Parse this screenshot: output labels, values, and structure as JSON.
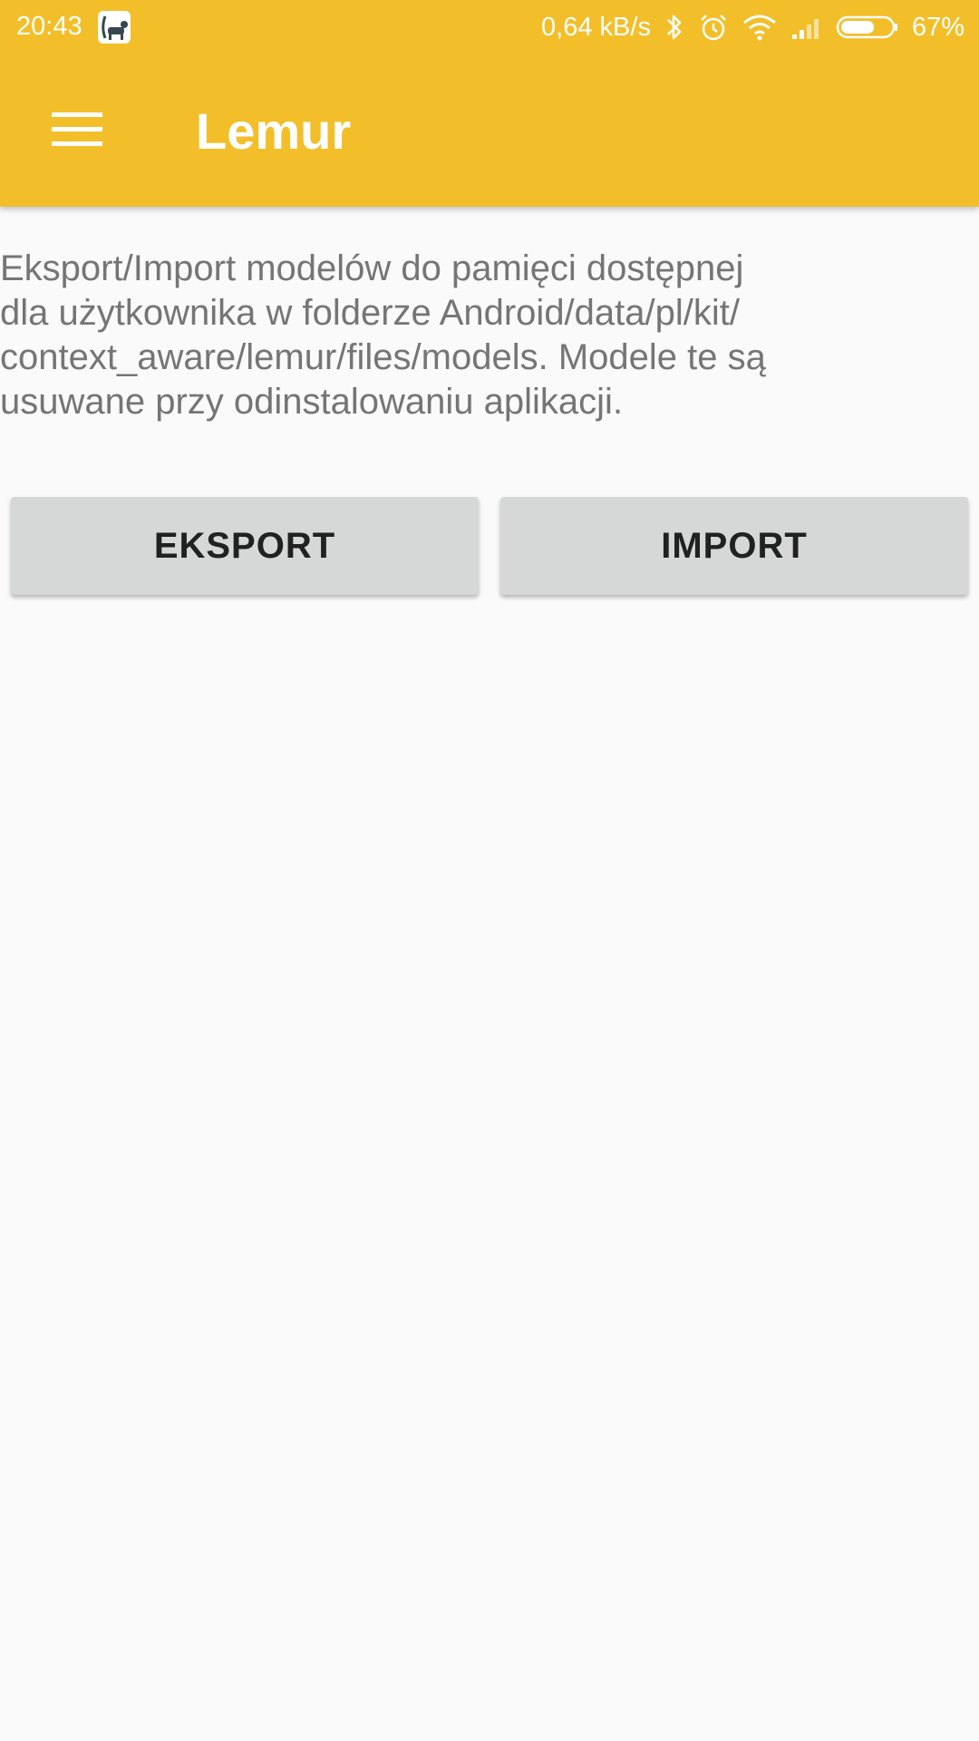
{
  "status_bar": {
    "time": "20:43",
    "network_speed": "0,64 kB/s",
    "battery_percent": "67%",
    "battery_level": 0.67,
    "icons": [
      "lemur-app-icon",
      "bluetooth-icon",
      "alarm-icon",
      "wifi-icon",
      "signal-icon",
      "battery-icon"
    ]
  },
  "toolbar": {
    "title": "Lemur",
    "menu_icon": "hamburger-menu-icon"
  },
  "main": {
    "description": "Eksport/Import modelów do pamięci dostępnej\ndla użytkownika w folderze Android/data/pl/kit/\ncontext_aware/lemur/files/models. Modele te są\nusuwane przy odinstalowaniu aplikacji.",
    "export_label": "EKSPORT",
    "import_label": "IMPORT"
  },
  "colors": {
    "primary": "#f2bf2a",
    "background": "#fafafa",
    "button": "#d6d7d7",
    "description_text": "#757575"
  }
}
